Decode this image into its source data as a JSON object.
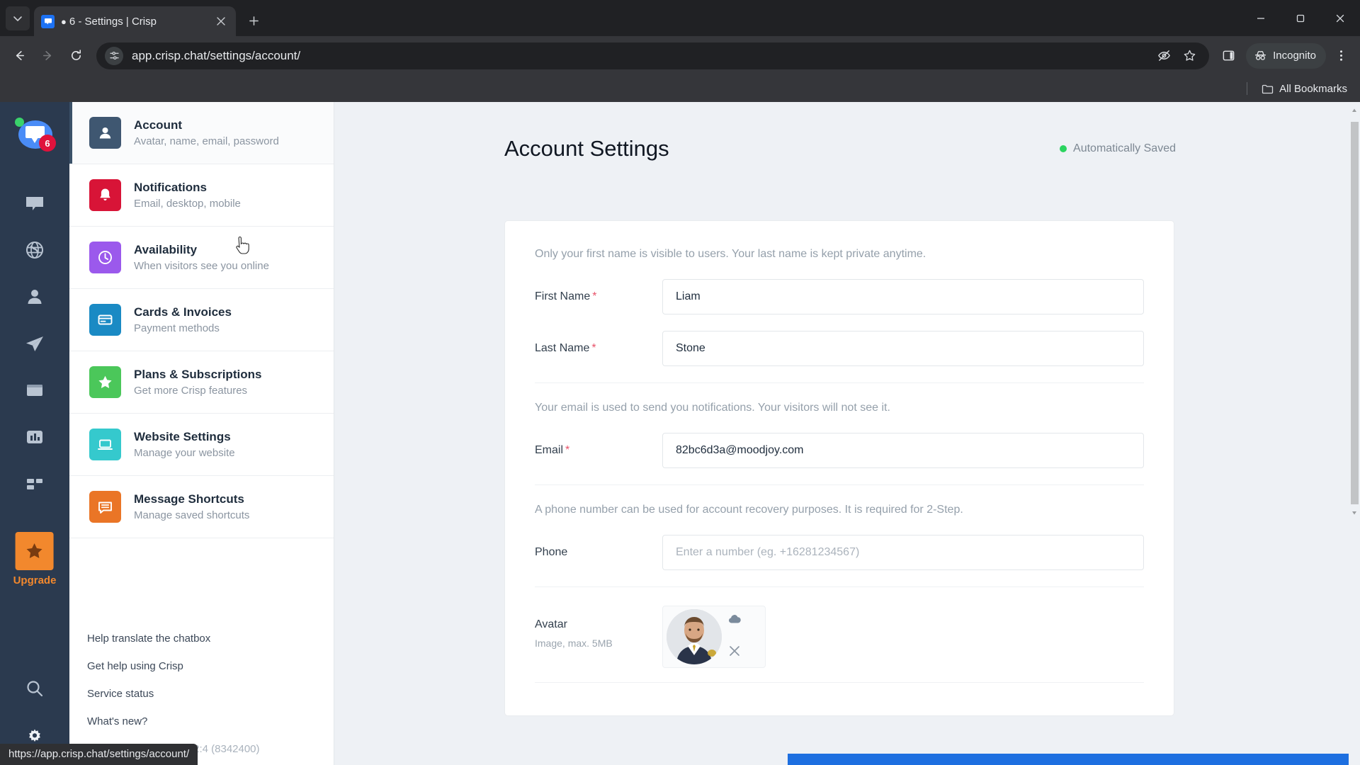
{
  "browser": {
    "tab": {
      "title": "6 - Settings | Crisp",
      "bubble_glyph": "●",
      "favicon_name": "crisp-favicon"
    },
    "new_tab_label": "+",
    "url": "app.crisp.chat/settings/account/",
    "profile_label": "Incognito",
    "bookmarks_label": "All Bookmarks",
    "status_url": "https://app.crisp.chat/settings/account/"
  },
  "rail": {
    "unread_badge": "6",
    "upgrade_label": "Upgrade",
    "icons": [
      "inbox-icon",
      "globe-icon",
      "contacts-icon",
      "campaigns-icon",
      "helpdesk-icon",
      "analytics-icon",
      "plugins-icon"
    ],
    "bottom_icons": [
      "search-icon",
      "gear-icon"
    ]
  },
  "settings_nav": {
    "items": [
      {
        "title": "Account",
        "sub": "Avatar, name, email, password",
        "icon": "user-icon",
        "color": "#3f5771",
        "active": true
      },
      {
        "title": "Notifications",
        "sub": "Email, desktop, mobile",
        "icon": "bell-icon",
        "color": "#d81437",
        "active": false
      },
      {
        "title": "Availability",
        "sub": "When visitors see you online",
        "icon": "clock-icon",
        "color": "#9b59ec",
        "active": false
      },
      {
        "title": "Cards & Invoices",
        "sub": "Payment methods",
        "icon": "card-icon",
        "color": "#1a8ac4",
        "active": false
      },
      {
        "title": "Plans & Subscriptions",
        "sub": "Get more Crisp features",
        "icon": "star-icon",
        "color": "#4bc council",
        "active": false
      },
      {
        "title": "Website Settings",
        "sub": "Manage your website",
        "icon": "laptop-icon",
        "color": "#35c9cd",
        "active": false
      },
      {
        "title": "Message Shortcuts",
        "sub": "Manage saved shortcuts",
        "icon": "shortcut-icon",
        "color": "#ea7526",
        "active": false
      }
    ],
    "footer_links": [
      "Help translate the chatbox",
      "Get help using Crisp",
      "Service status",
      "What's new?"
    ],
    "version": "Version: 2023.12.18, 12:4 (8342400)"
  },
  "main": {
    "page_title": "Account Settings",
    "saved_status": "Automatically Saved",
    "saved_color": "#2bd45f",
    "name_hint": "Only your first name is visible to users. Your last name is kept private anytime.",
    "email_hint": "Your email is used to send you notifications. Your visitors will not see it.",
    "phone_hint": "A phone number can be used for account recovery purposes. It is required for 2-Step.",
    "fields": {
      "first_name": {
        "label": "First Name",
        "required": "*",
        "value": "Liam"
      },
      "last_name": {
        "label": "Last Name",
        "required": "*",
        "value": "Stone"
      },
      "email": {
        "label": "Email",
        "required": "*",
        "value": "82bc6d3a@moodjoy.com"
      },
      "phone": {
        "label": "Phone",
        "required": "",
        "value": "",
        "placeholder": "Enter a number (eg. +16281234567)"
      }
    },
    "avatar": {
      "label": "Avatar",
      "sub": "Image, max. 5MB",
      "upload_icon": "cloud-upload-icon",
      "remove_icon": "close-icon"
    }
  }
}
